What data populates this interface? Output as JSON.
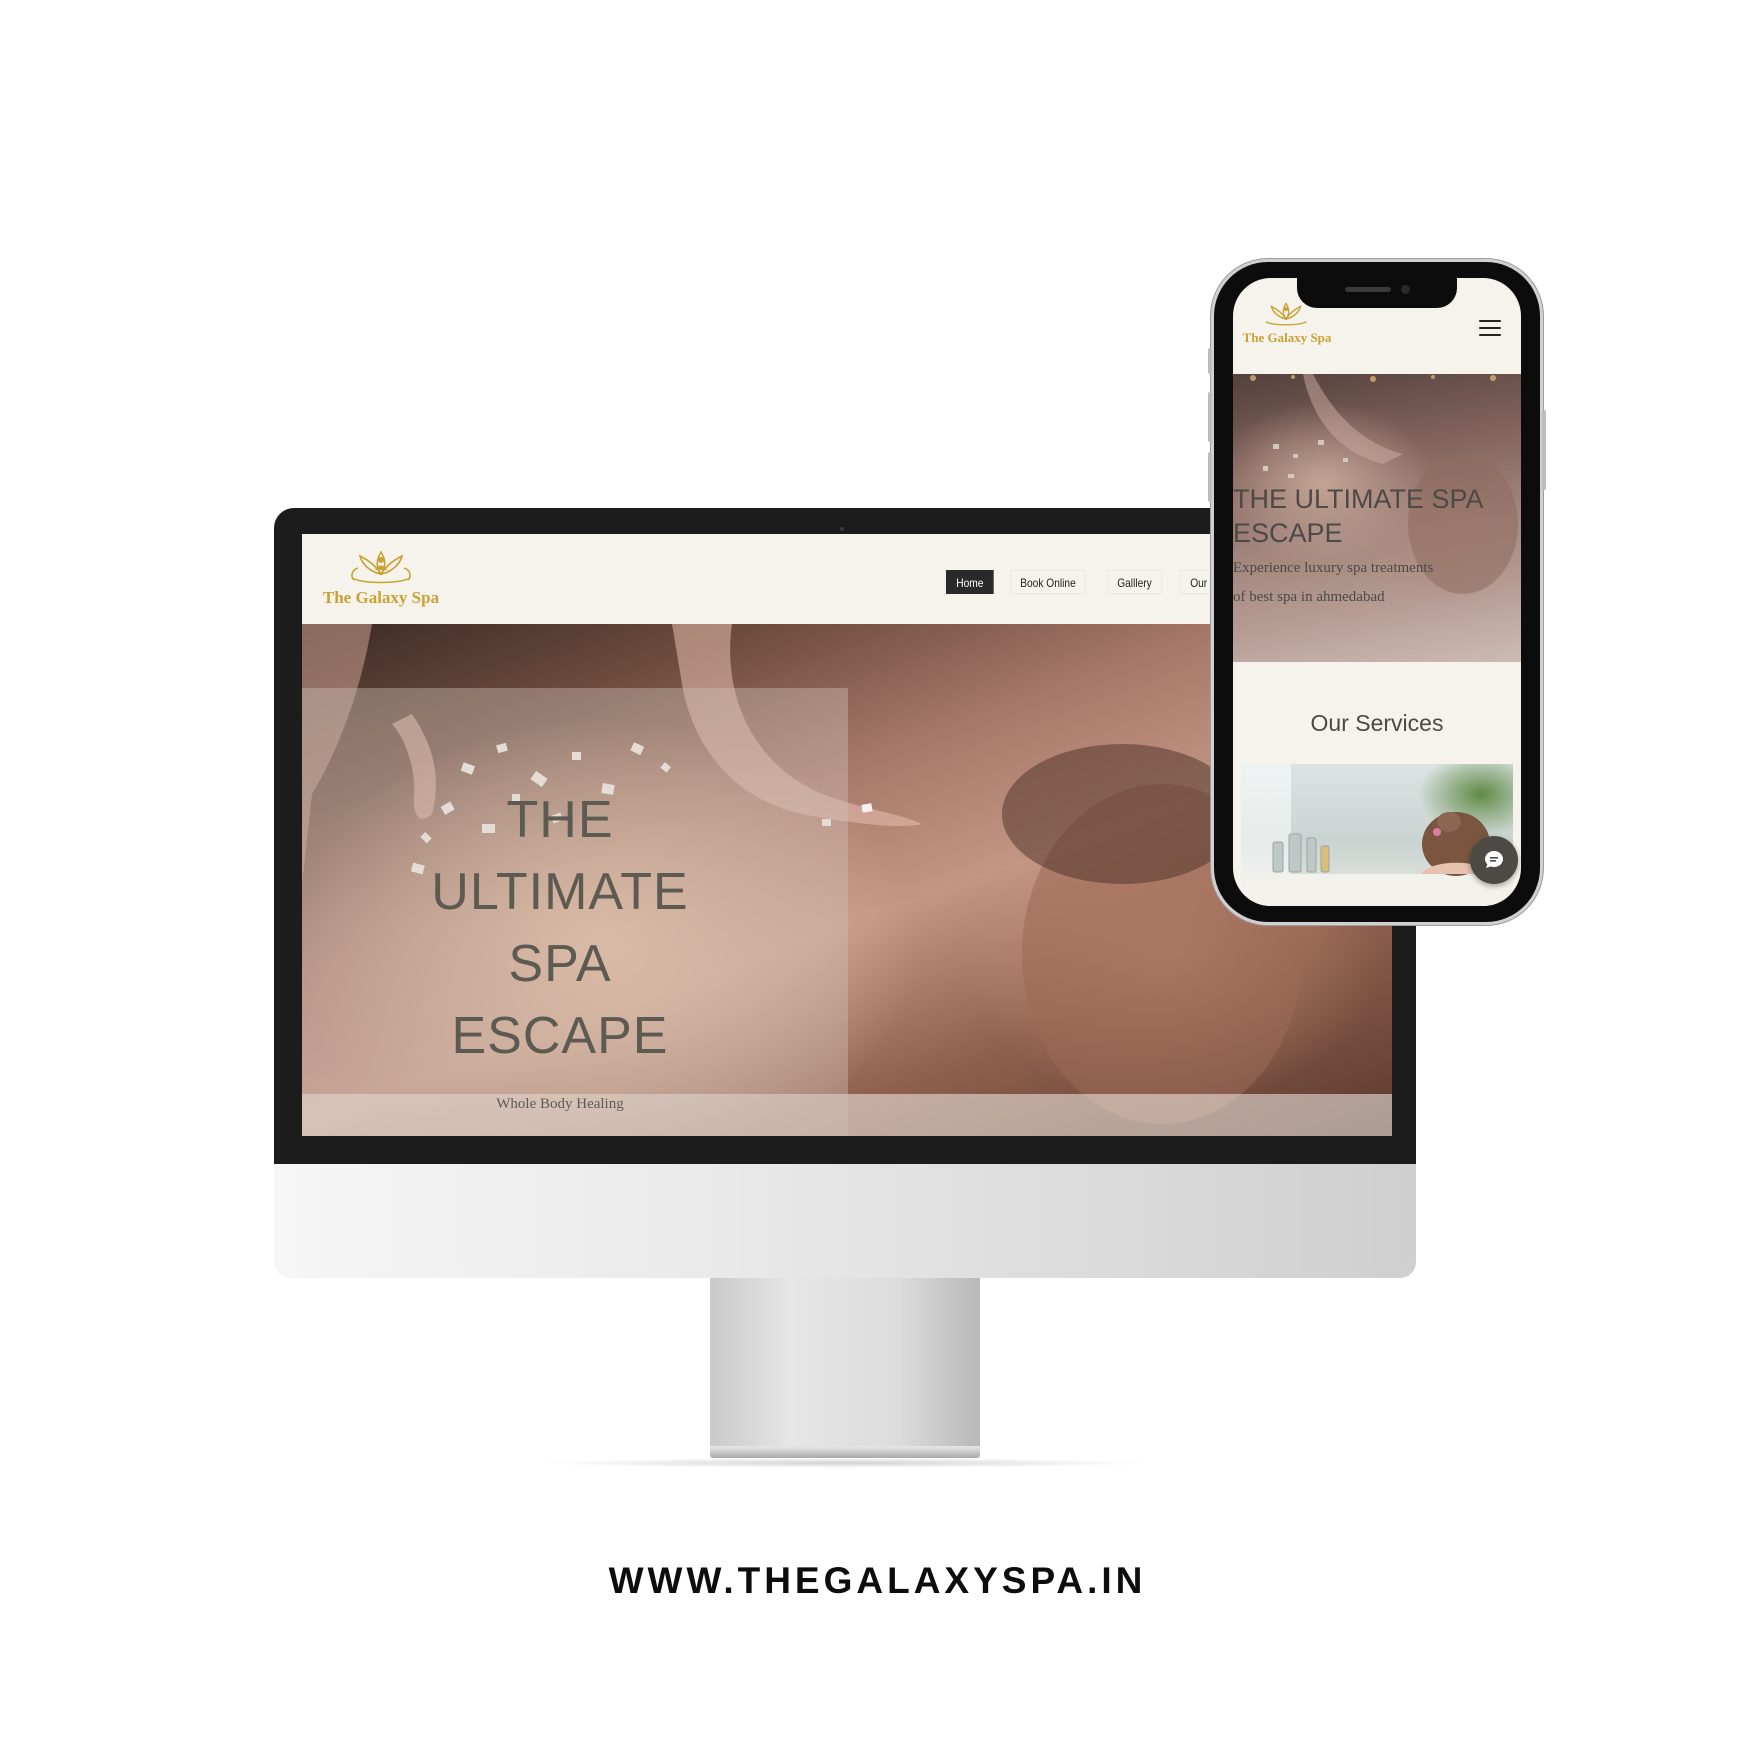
{
  "desktop": {
    "logo_text": "The Galaxy Spa",
    "nav": [
      "Home",
      "Book Online",
      "Galllery",
      "Our Service"
    ],
    "active_nav": "Home",
    "hero": {
      "title_lines": [
        "THE",
        "ULTIMATE",
        "SPA",
        "ESCAPE"
      ],
      "subtitle": "Whole Body Healing"
    }
  },
  "mobile": {
    "logo_text": "The Galaxy Spa",
    "menu_icon": "hamburger-menu-icon",
    "hero": {
      "title_lines": [
        "THE ULTIMATE SPA",
        "ESCAPE"
      ],
      "text_lines": [
        "Experience luxury spa treatments",
        "of best spa in ahmedabad"
      ]
    },
    "services_heading": "Our Services",
    "chat_icon": "chat-icon"
  },
  "caption": "WWW.THEGALAXYSPA.IN",
  "colors": {
    "brand_gold": "#c9a233",
    "page_bg": "#f6f3ec",
    "text_dark": "#4d4944",
    "nav_active_bg": "#2a2a2a"
  }
}
